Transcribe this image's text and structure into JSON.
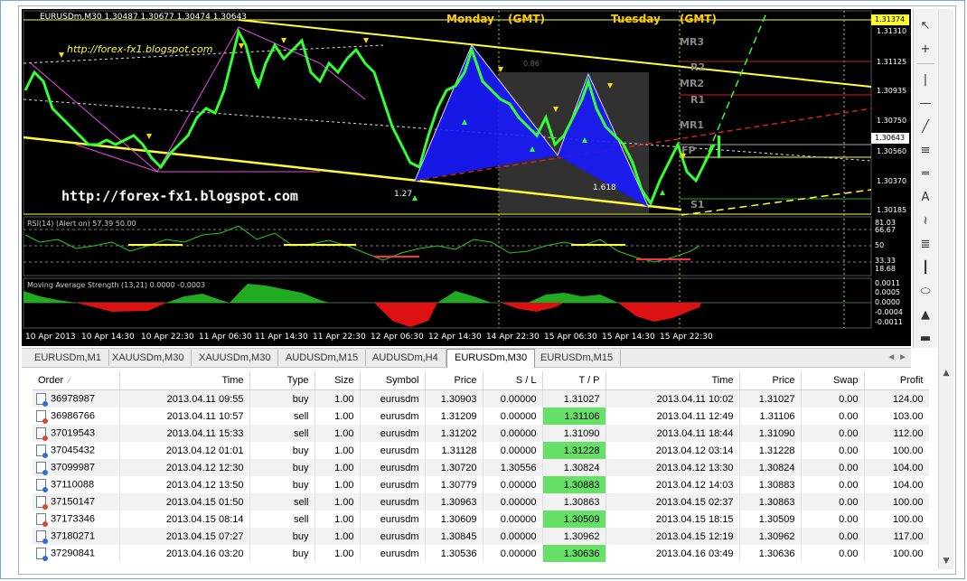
{
  "chart": {
    "title": "EURUSDm,M30  1.30487  1.30677  1.30474  1.30643",
    "watermark_top": "http://forex-fx1.blogspot.com",
    "watermark_bottom": "http://forex-fx1.blogspot.com",
    "session_labels": [
      "Monday",
      "(GMT)",
      "Tuesday",
      "(GMT)"
    ],
    "price_axis": [
      "1.31374",
      "1.31310",
      "1.31125",
      "1.30935",
      "1.30750",
      "1.30643",
      "1.30560",
      "1.30370",
      "1.30185"
    ],
    "pivot_labels": [
      "MR3",
      "R2",
      "MR2",
      "R1",
      "MR1",
      "FP",
      "S1"
    ],
    "pattern_labels": [
      "1.618",
      "1.27",
      "0.86",
      "1.618",
      "1.618"
    ],
    "rsi_label": "RSI(14) (Alert on) 57.39 50.00",
    "rsi_axis": [
      "81.03",
      "66.67",
      "50",
      "33.33",
      "18.68"
    ],
    "mas_label": "Moving Average Strength (13,21) 0.0000 -0.0003",
    "mas_axis": [
      "0.0011",
      "0.0005",
      "0.0000",
      "-0.0004",
      "-0.0011"
    ],
    "time_axis": [
      "10 Apr 2013",
      "10 Apr 14:30",
      "10 Apr 22:30",
      "11 Apr 06:30",
      "11 Apr 14:30",
      "11 Apr 22:30",
      "12 Apr 06:30",
      "12 Apr 14:30",
      "14 Apr 22:30",
      "15 Apr 06:30",
      "15 Apr 14:30",
      "15 Apr 22:30"
    ],
    "colors": {
      "bg": "#000000",
      "candle": "#33ff33",
      "trend": "#ffff33",
      "pattern": "#1a1aff",
      "pivot": "#cc2222",
      "rsi_line": "#22cc22",
      "mas_green": "#22aa22",
      "mas_red": "#dd1111"
    }
  },
  "toolbar": {
    "icons": [
      "cursor-icon",
      "crosshair-icon",
      "vertical-line-icon",
      "horizontal-line-icon",
      "trendline-icon",
      "fibonacci-icon",
      "text-icon",
      "andrews-pitchfork-icon",
      "gann-fan-icon",
      "channel-icon",
      "parallel-lines-icon",
      "ellipse-icon",
      "triangle-icon",
      "rectangle-icon"
    ]
  },
  "tabs": [
    "EURUSDm,M1",
    "XAUUSDm,M30",
    "XAUUSDm,M30",
    "AUDUSDm,M15",
    "AUDUSDm,H4",
    "EURUSDm,M30",
    "EURUSDm,M15"
  ],
  "active_tab": "EURUSDm,M30",
  "table": {
    "headers": [
      "Order",
      "Time",
      "Type",
      "Size",
      "Symbol",
      "Price",
      "S / L",
      "T / P",
      "Time",
      "Price",
      "Swap",
      "Profit"
    ],
    "rows": [
      [
        "36978987",
        "2013.04.11 09:55",
        "buy",
        "1.00",
        "eurusdm",
        "1.30903",
        "0.00000",
        "1.31027",
        "2013.04.11 10:02",
        "1.31027",
        "0.00",
        "124.00"
      ],
      [
        "36986766",
        "2013.04.11 10:57",
        "sell",
        "1.00",
        "eurusdm",
        "1.31209",
        "0.00000",
        "1.31106",
        "2013.04.11 12:49",
        "1.31106",
        "0.00",
        "103.00"
      ],
      [
        "37019543",
        "2013.04.11 15:33",
        "sell",
        "1.00",
        "eurusdm",
        "1.31202",
        "0.00000",
        "1.31090",
        "2013.04.11 18:44",
        "1.31090",
        "0.00",
        "112.00"
      ],
      [
        "37045432",
        "2013.04.12 01:01",
        "buy",
        "1.00",
        "eurusdm",
        "1.31128",
        "0.00000",
        "1.31228",
        "2013.04.12 03:14",
        "1.31228",
        "0.00",
        "100.00"
      ],
      [
        "37099987",
        "2013.04.12 12:30",
        "buy",
        "1.00",
        "eurusdm",
        "1.30720",
        "1.30556",
        "1.30824",
        "2013.04.12 13:30",
        "1.30824",
        "0.00",
        "104.00"
      ],
      [
        "37110088",
        "2013.04.12 13:50",
        "buy",
        "1.00",
        "eurusdm",
        "1.30779",
        "0.00000",
        "1.30883",
        "2013.04.12 14:03",
        "1.30883",
        "0.00",
        "104.00"
      ],
      [
        "37150147",
        "2013.04.15 01:50",
        "sell",
        "1.00",
        "eurusdm",
        "1.30963",
        "0.00000",
        "1.30863",
        "2013.04.15 02:37",
        "1.30863",
        "0.00",
        "100.00"
      ],
      [
        "37173346",
        "2013.04.15 08:14",
        "sell",
        "1.00",
        "eurusdm",
        "1.30609",
        "0.00000",
        "1.30509",
        "2013.04.15 18:15",
        "1.30509",
        "0.00",
        "100.00"
      ],
      [
        "37180271",
        "2013.04.15 07:27",
        "buy",
        "1.00",
        "eurusdm",
        "1.30845",
        "0.00000",
        "1.30962",
        "2013.04.15 12:19",
        "1.30962",
        "0.00",
        "117.00"
      ],
      [
        "37290841",
        "2013.04.16 03:20",
        "buy",
        "1.00",
        "eurusdm",
        "1.30536",
        "0.00000",
        "1.30636",
        "2013.04.16 03:49",
        "1.30636",
        "0.00",
        "100.00"
      ]
    ]
  }
}
